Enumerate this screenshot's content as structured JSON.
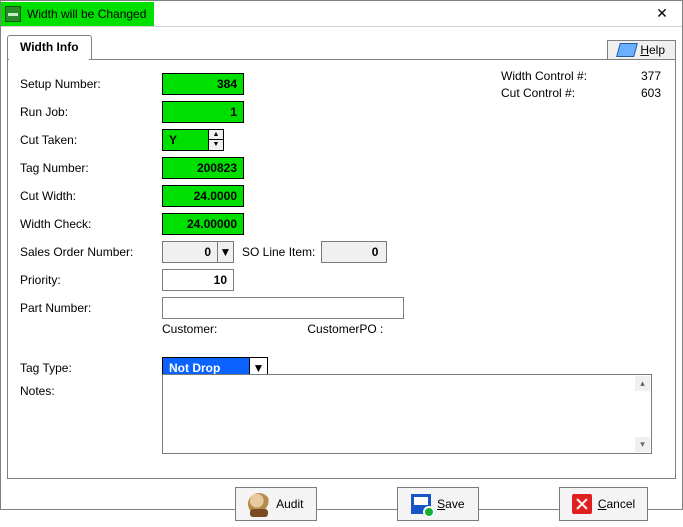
{
  "title": "Width will be Changed",
  "tab_label": "Width Info",
  "help_label": "Help",
  "metrics": {
    "width_control_label": "Width Control #:",
    "width_control_value": "377",
    "cut_control_label": "Cut Control #:",
    "cut_control_value": "603"
  },
  "labels": {
    "setup_number": "Setup Number:",
    "run_job": "Run Job:",
    "cut_taken": "Cut Taken:",
    "tag_number": "Tag Number:",
    "cut_width": "Cut Width:",
    "width_check": "Width Check:",
    "sales_order_number": "Sales Order Number:",
    "so_line_item": "SO Line Item:",
    "priority": "Priority:",
    "part_number": "Part Number:",
    "customer": "Customer:",
    "customer_po": "CustomerPO :",
    "tag_type": "Tag Type:",
    "notes": "Notes:"
  },
  "values": {
    "setup_number": "384",
    "run_job": "1",
    "cut_taken": "Y",
    "tag_number": "200823",
    "cut_width": "24.0000",
    "width_check": "24.00000",
    "sales_order_number": "0",
    "so_line_item": "0",
    "priority": "10",
    "part_number": "",
    "customer": "",
    "customer_po": "",
    "tag_type": "Not Drop",
    "notes": ""
  },
  "buttons": {
    "audit": "Audit",
    "save": "Save",
    "cancel": "Cancel"
  }
}
